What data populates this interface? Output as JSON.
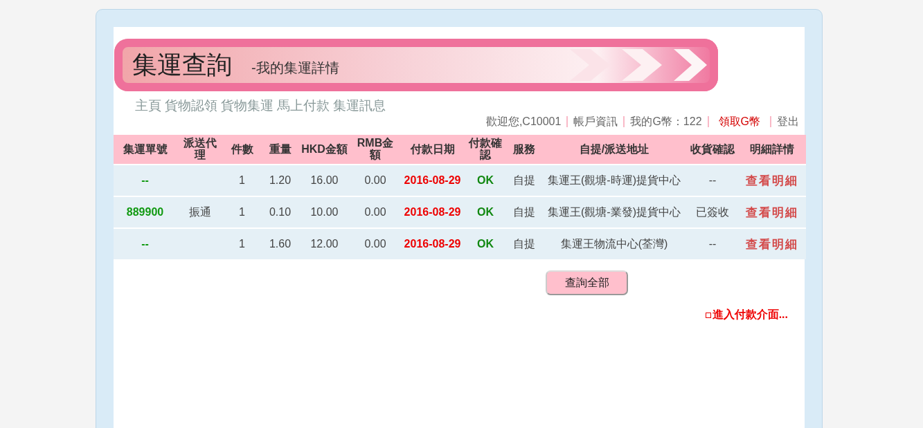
{
  "banner": {
    "title": "集運查詢",
    "subtitle": "-我的集運詳情"
  },
  "nav": [
    "主頁",
    "貨物認領",
    "貨物集運",
    "馬上付款",
    "集運訊息"
  ],
  "user_bar": [
    {
      "text": "歡迎您,C10001",
      "kind": "text"
    },
    {
      "text": "帳戶資訊",
      "kind": "link"
    },
    {
      "text": "我的G幣：122",
      "kind": "text"
    },
    {
      "text": "領取G幣",
      "kind": "highlight"
    },
    {
      "text": "登出",
      "kind": "link"
    }
  ],
  "table": {
    "columns": [
      "集運單號",
      "派送代理",
      "件數",
      "重量",
      "HKD金額",
      "RMB金額",
      "付款日期",
      "付款確認",
      "服務",
      "自提/派送地址",
      "收貨確認",
      "明細詳情"
    ],
    "rows": [
      [
        "--",
        "",
        "1",
        "1.20",
        "16.00",
        "0.00",
        "2016-08-29",
        "OK",
        "自提",
        "集運王(觀塘-時運)提貨中心",
        "--",
        "查看明細"
      ],
      [
        "889900",
        "振通",
        "1",
        "0.10",
        "10.00",
        "0.00",
        "2016-08-29",
        "OK",
        "自提",
        "集運王(觀塘-業發)提貨中心",
        "已簽收",
        "查看明細"
      ],
      [
        "--",
        "",
        "1",
        "1.60",
        "12.00",
        "0.00",
        "2016-08-29",
        "OK",
        "自提",
        "集運王物流中心(荃灣)",
        "--",
        "查看明細"
      ]
    ]
  },
  "query_all_button": "查詢全部",
  "pay_link": "進入付款介面..."
}
